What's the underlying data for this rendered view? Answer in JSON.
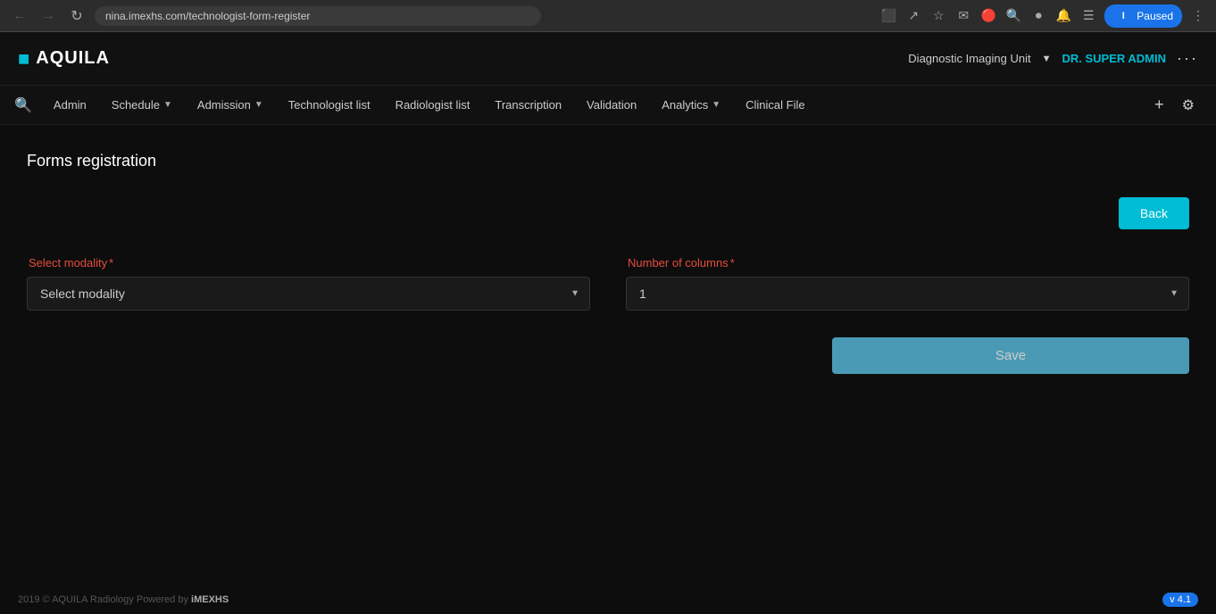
{
  "browser": {
    "url": "nina.imexhs.com/technologist-form-register",
    "paused_label": "Paused",
    "user_initial": "I"
  },
  "header": {
    "logo": "AQUILA",
    "unit": "Diagnostic Imaging Unit",
    "admin": "DR. SUPER ADMIN"
  },
  "nav": {
    "search_icon": "🔍",
    "items": [
      {
        "label": "Admin",
        "has_chevron": false
      },
      {
        "label": "Schedule",
        "has_chevron": true
      },
      {
        "label": "Admission",
        "has_chevron": true
      },
      {
        "label": "Technologist list",
        "has_chevron": false
      },
      {
        "label": "Radiologist list",
        "has_chevron": false
      },
      {
        "label": "Transcription",
        "has_chevron": false
      },
      {
        "label": "Validation",
        "has_chevron": false
      },
      {
        "label": "Analytics",
        "has_chevron": true
      },
      {
        "label": "Clinical File",
        "has_chevron": false
      }
    ]
  },
  "page": {
    "title": "Forms registration",
    "back_button": "Back",
    "select_modality_label": "Select modality",
    "select_modality_required": "*",
    "select_modality_placeholder": "Select modality",
    "number_of_columns_label": "Number of columns",
    "number_of_columns_required": "*",
    "number_of_columns_value": "1",
    "save_button": "Save"
  },
  "footer": {
    "copyright": "2019 © AQUILA Radiology Powered by",
    "brand": "iMEXHS",
    "version": "v 4.1"
  }
}
